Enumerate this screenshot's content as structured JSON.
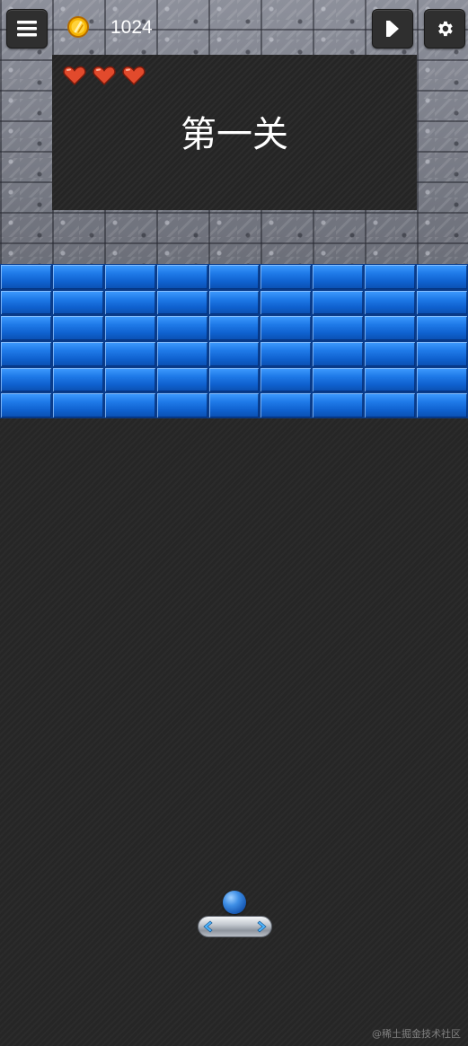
{
  "toolbar": {
    "menu_icon": "hamburger-menu-icon",
    "play_icon": "play-icon",
    "settings_icon": "gear-icon"
  },
  "score": {
    "icon": "coin-icon",
    "value": "1024"
  },
  "level": {
    "title": "第一关",
    "lives": 3,
    "life_icon": "heart-icon"
  },
  "bricks": {
    "rows": 6,
    "columns": 9,
    "color": "#1f7ae8"
  },
  "ball": {
    "color": "#2f7ad4"
  },
  "paddle": {
    "arrow_color": "#4fb6ff"
  },
  "watermark": "@稀土掘金技术社区"
}
